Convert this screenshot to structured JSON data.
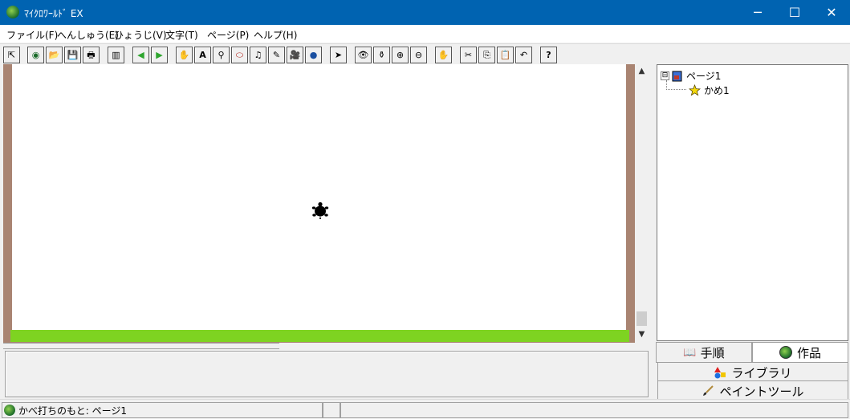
{
  "window": {
    "title": "ﾏｲｸﾛﾜｰﾙﾄﾞ EX",
    "minimize": "─",
    "maximize": "☐",
    "close": "✕"
  },
  "menu": [
    "ファイル(F)",
    "へんしゅう(E)",
    "ひょうじ(V)",
    "文字(T)",
    "ページ(P)",
    "ヘルプ(H)"
  ],
  "toolbar": {
    "icons": [
      "cursor-small",
      "world",
      "open-folder",
      "save",
      "print",
      "panel",
      "arrow-left",
      "arrow-right",
      "character",
      "text-A",
      "stand",
      "capsule",
      "music-note",
      "pen",
      "video-camera",
      "globe",
      "pointer",
      "eye",
      "stamp",
      "zoom-in",
      "zoom-out",
      "stop-hand",
      "scissors",
      "copy",
      "paste",
      "undo",
      "help"
    ],
    "glyphs": [
      "⇱",
      "◉",
      "📂",
      "💾",
      "🖶",
      "▥",
      "◀",
      "▶",
      "✋",
      "A",
      "⚲",
      "⬭",
      "♫",
      "✎",
      "🎥",
      "●",
      "➤",
      "👁",
      "⚱",
      "⊕",
      "⊖",
      "✋",
      "✂",
      "⎘",
      "📋",
      "↶",
      "?"
    ],
    "colors": {
      "arrow": "#2ea52e",
      "stop": "#d0312d"
    }
  },
  "tree": {
    "root": {
      "label": "ページ1",
      "expander": "⊟"
    },
    "children": [
      {
        "label": "かめ1"
      }
    ]
  },
  "tabs": {
    "steps": "手順",
    "work": "作品",
    "library": "ライブラリ",
    "paint": "ペイントツール"
  },
  "status": {
    "text": "かべ打ちのもと: ページ1"
  },
  "scroll": {
    "up": "▲",
    "down": "▼"
  },
  "colors": {
    "title_bar": "#0063b1",
    "canvas_border": "#a98472",
    "grass": "#7ed321"
  }
}
